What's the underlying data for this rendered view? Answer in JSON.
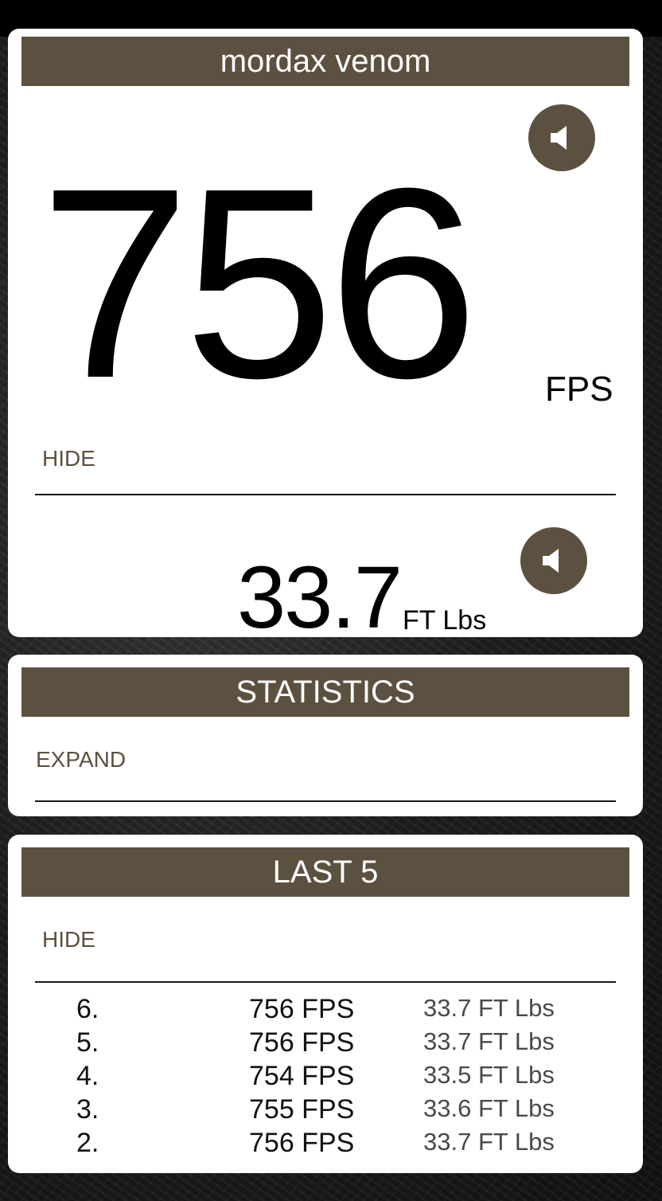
{
  "gun": {
    "name": "mordax venom",
    "fps_value": "756",
    "fps_unit": "FPS",
    "hide_label": "HIDE",
    "energy_value": "33.7",
    "energy_unit": "FT Lbs"
  },
  "statistics": {
    "title": "STATISTICS",
    "expand_label": "EXPAND"
  },
  "last5": {
    "title": "LAST 5",
    "hide_label": "HIDE",
    "shots": [
      {
        "num": "6.",
        "fps": "756 FPS",
        "energy": "33.7 FT Lbs"
      },
      {
        "num": "5.",
        "fps": "756 FPS",
        "energy": "33.7 FT Lbs"
      },
      {
        "num": "4.",
        "fps": "754 FPS",
        "energy": "33.5 FT Lbs"
      },
      {
        "num": "3.",
        "fps": "755 FPS",
        "energy": "33.6 FT Lbs"
      },
      {
        "num": "2.",
        "fps": "756 FPS",
        "energy": "33.7 FT Lbs"
      }
    ]
  },
  "icons": {
    "fps_sound": "speaker-icon",
    "energy_sound": "speaker-icon"
  },
  "colors": {
    "accent": "#5c5140",
    "card_bg": "#ffffff",
    "top_bar": "#000000"
  }
}
